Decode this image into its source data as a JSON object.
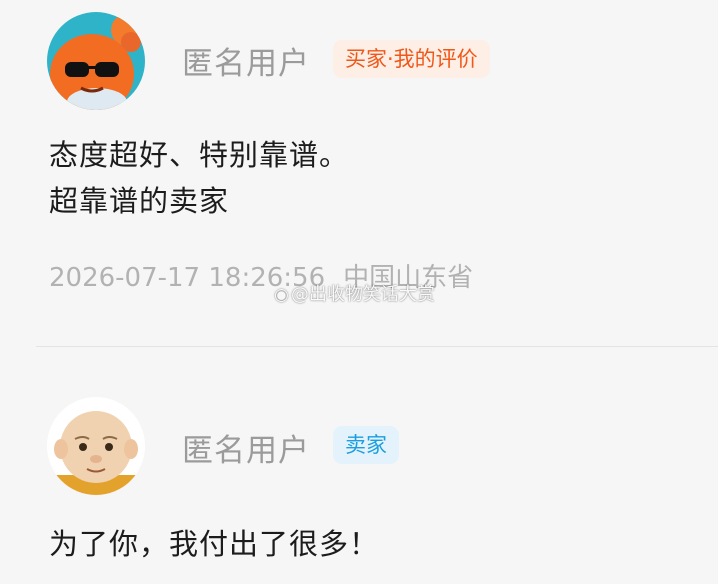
{
  "reviews": [
    {
      "username": "匿名用户",
      "badge": "买家·我的评价",
      "content_lines": [
        "态度超好、特别靠谱。",
        "超靠谱的卖家"
      ],
      "datetime": "2026-07-17 18:26:56",
      "location": "中国山东省",
      "avatar_icon": "orange-crab-sunglasses-avatar"
    },
    {
      "username": "匿名用户",
      "badge": "卖家",
      "content_lines": [
        "为了你，我付出了很多！"
      ],
      "avatar_icon": "bald-cartoon-man-avatar"
    }
  ],
  "watermark": {
    "icon": "weibo-icon",
    "text": "@出收物笑话大赏"
  },
  "colors": {
    "badge_buyer_text": "#f0581a",
    "badge_buyer_bg": "#fdeee6",
    "badge_seller_text": "#1b9ee0",
    "badge_seller_bg": "#e4f3fb"
  }
}
